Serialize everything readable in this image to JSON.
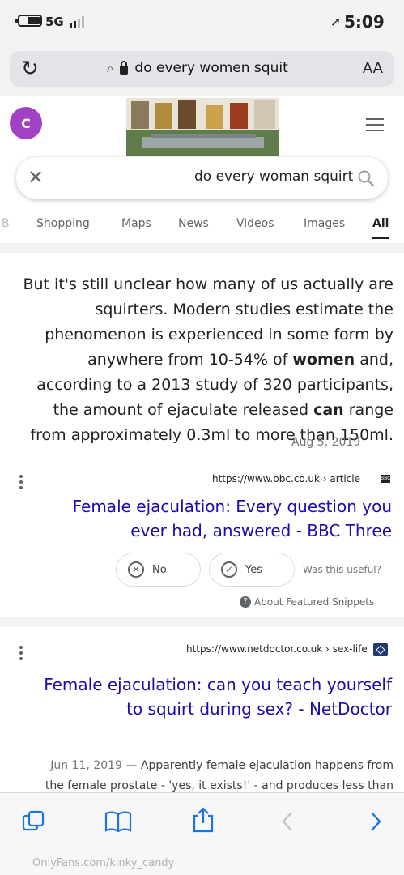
{
  "status": {
    "time": "5:09",
    "network": "5G",
    "location_glyph": "➚"
  },
  "address_bar": {
    "url_text": "do every women squit",
    "aa_label": "AA"
  },
  "header": {
    "avatar_letter": "C"
  },
  "search": {
    "query": "do every woman squirt"
  },
  "tabs": [
    "All",
    "Images",
    "Videos",
    "News",
    "Maps",
    "Shopping",
    "B"
  ],
  "snippet": {
    "text_before_women": "But it's still unclear how many of us actually are squirters. Modern studies estimate the phenomenon is experienced in some form by anywhere from 10-54% of ",
    "women": "women",
    "text_mid": " and, according to a 2013 study of 320 participants, the amount of ejaculate released ",
    "can": "can",
    "text_after": " range from approximately 0.3ml to more than 150ml.",
    "date": "Aug 5, 2019",
    "cite": "https://www.bbc.co.uk › article",
    "favicon_label": "BBC",
    "title": "Female ejaculation: Every question you ever had, answered - BBC Three",
    "useful_label": "Was this useful?",
    "yes_label": "Yes",
    "no_label": "No",
    "about_label": "About Featured Snippets"
  },
  "result2": {
    "cite": "https://www.netdoctor.co.uk › sex-life",
    "title": "Female ejaculation: can you teach yourself to squirt during sex? - NetDoctor",
    "date": "Jun 11, 2019",
    "snippet_line1": "Apparently female ejaculation happens from",
    "snippet_line2": "the female prostate - 'yes, it exists!' - and produces less than"
  },
  "watermark": "OnlyFans.com/kinky_candy",
  "colors": {
    "link": "#1a0dab",
    "avatar": "#a142c4",
    "toolbar_icon": "#1a73e8"
  }
}
